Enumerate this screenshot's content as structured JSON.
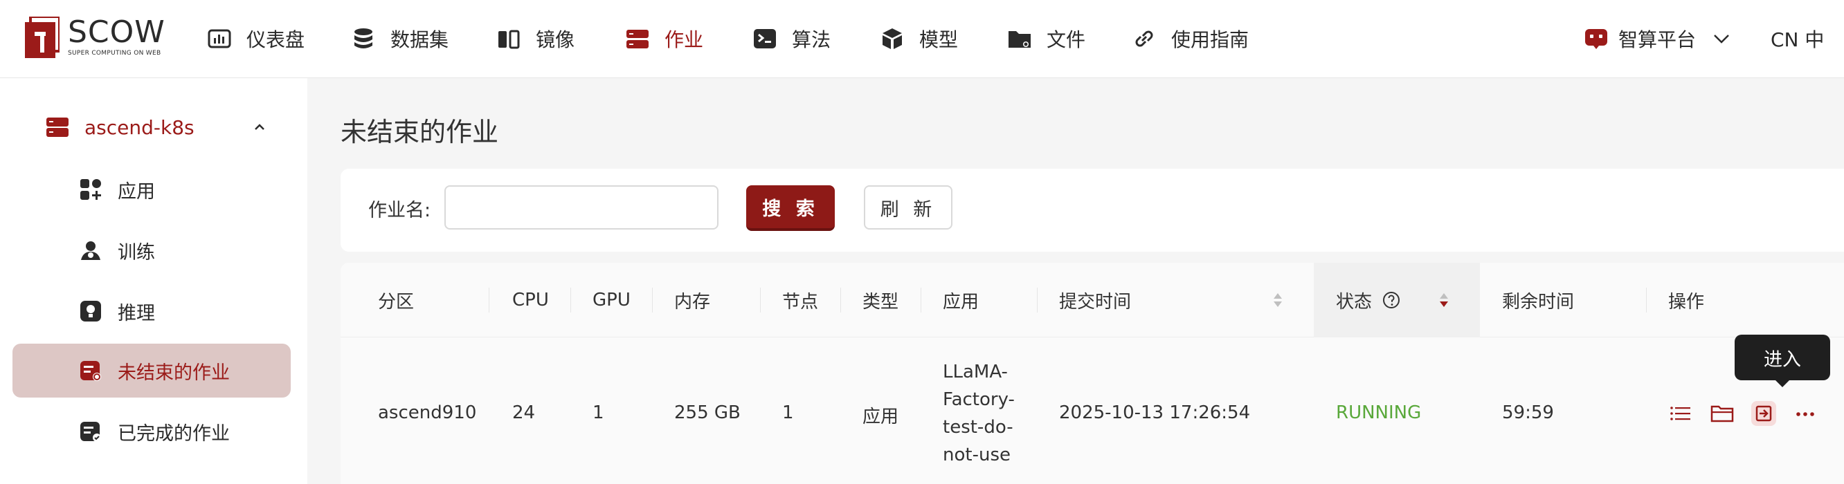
{
  "brand": {
    "name": "SCOW",
    "tagline": "SUPER COMPUTING ON WEB",
    "accent": "#9b1b19"
  },
  "nav": {
    "items": [
      {
        "label": "仪表盘",
        "icon": "dashboard-icon"
      },
      {
        "label": "数据集",
        "icon": "database-icon"
      },
      {
        "label": "镜像",
        "icon": "image-icon"
      },
      {
        "label": "作业",
        "icon": "server-job-icon",
        "active": true
      },
      {
        "label": "算法",
        "icon": "terminal-icon"
      },
      {
        "label": "模型",
        "icon": "cube-icon"
      },
      {
        "label": "文件",
        "icon": "folder-icon"
      },
      {
        "label": "使用指南",
        "icon": "link-icon"
      }
    ],
    "platform": "智算平台",
    "language": "CN 中"
  },
  "sidebar": {
    "group": "ascend-k8s",
    "items": [
      {
        "label": "应用",
        "icon": "apps-icon"
      },
      {
        "label": "训练",
        "icon": "train-icon"
      },
      {
        "label": "推理",
        "icon": "inference-icon"
      },
      {
        "label": "未结束的作业",
        "icon": "running-jobs-icon",
        "active": true
      },
      {
        "label": "已完成的作业",
        "icon": "finished-jobs-icon"
      }
    ]
  },
  "page": {
    "title": "未结束的作业"
  },
  "search": {
    "label": "作业名:",
    "value": "",
    "placeholder": "",
    "search_button": "搜 索",
    "refresh_button": "刷 新"
  },
  "table": {
    "columns": [
      "分区",
      "CPU",
      "GPU",
      "内存",
      "节点",
      "类型",
      "应用",
      "提交时间",
      "状态",
      "剩余时间",
      "操作"
    ],
    "rows": [
      {
        "partition": "ascend910",
        "cpu": "24",
        "gpu": "1",
        "memory": "255 GB",
        "nodes": "1",
        "type": "应用",
        "app": "LLaMA-Factory-test-do-not-use",
        "app_lines": [
          "LLaMA-",
          "Factory-",
          "test-do-",
          "not-use"
        ],
        "submit_time": "2025-10-13 17:26:54",
        "status": "RUNNING",
        "remaining": "59:59"
      }
    ],
    "tooltip": "进入",
    "status_color": "#59a83a"
  }
}
